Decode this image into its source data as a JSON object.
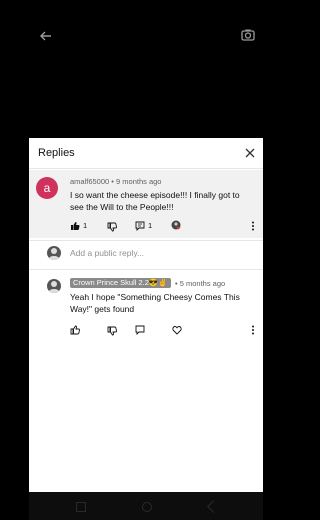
{
  "top": {
    "back_icon": "arrow-left-icon",
    "camera_icon": "camera-icon"
  },
  "panel": {
    "title": "Replies",
    "close_icon": "close-icon"
  },
  "comment1": {
    "avatar_letter": "a",
    "avatar_color": "#d0325e",
    "author": "amalf65000",
    "time": "9 months ago",
    "text": "I so want the cheese episode!!! I finally got to see the Will to the People!!!",
    "likes": "1",
    "replies": "1"
  },
  "add_reply": {
    "placeholder": "Add a public reply..."
  },
  "comment2": {
    "author": "Crown Prince Skull 2.2😎✌",
    "time": "5 months ago",
    "text": "Yeah I hope \"Something Cheesy Comes This Way!\" gets found"
  }
}
